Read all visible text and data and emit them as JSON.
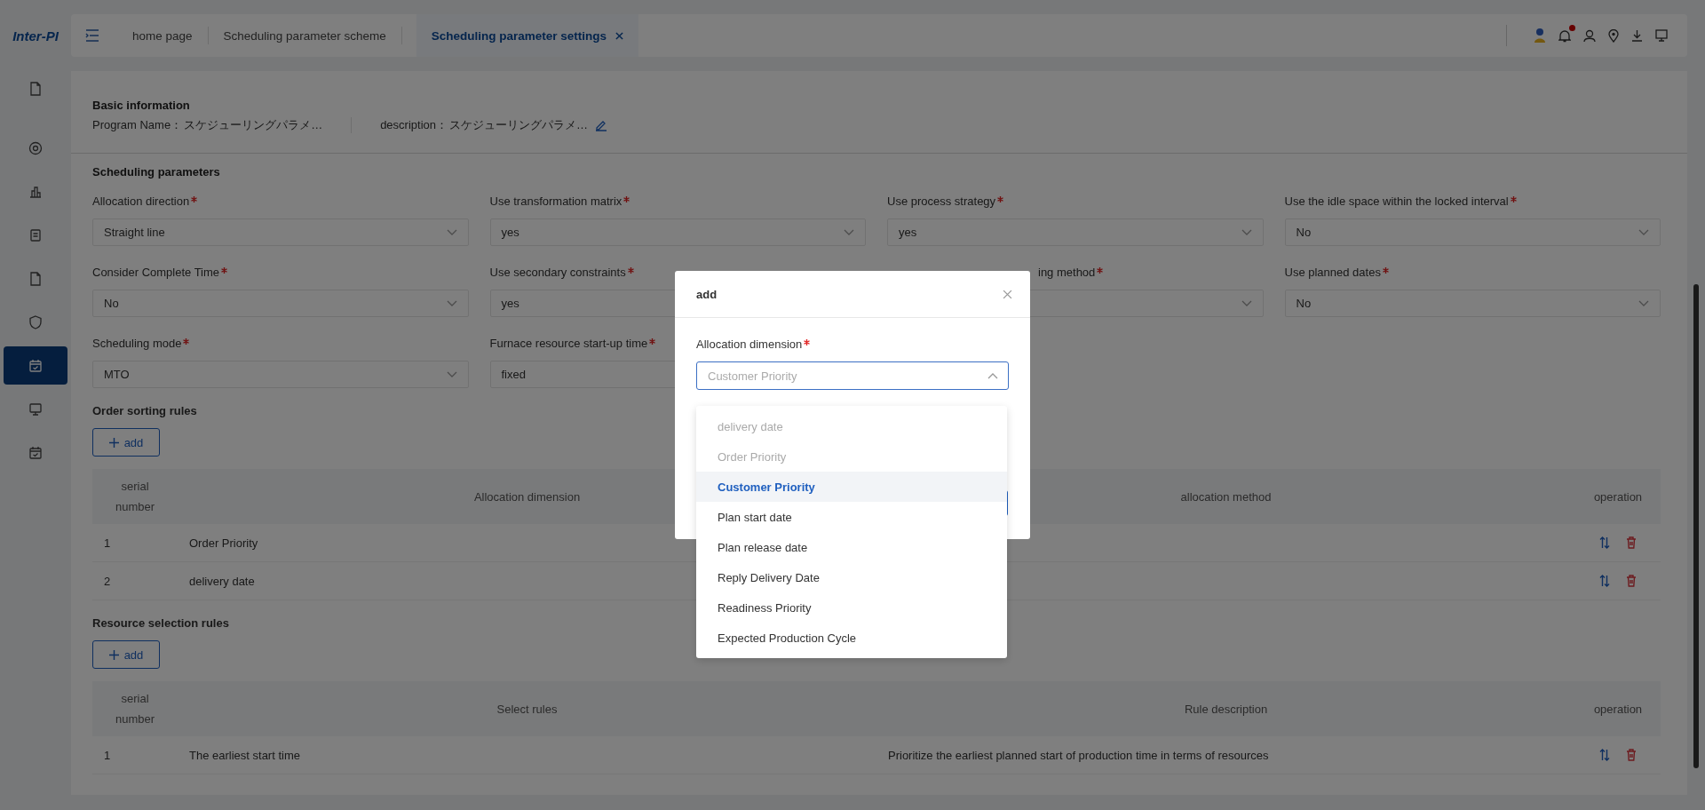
{
  "brand": {
    "logo": "Inter-PI"
  },
  "sidebar": {
    "items": [
      {
        "selected": false
      },
      {
        "selected": false
      },
      {
        "selected": false
      },
      {
        "selected": false
      },
      {
        "selected": false
      },
      {
        "selected": false
      },
      {
        "selected": true
      },
      {
        "selected": false
      },
      {
        "selected": false
      }
    ]
  },
  "tabs": [
    {
      "label": "home page",
      "selected": false
    },
    {
      "label": "Scheduling parameter scheme",
      "selected": false
    },
    {
      "label": "Scheduling parameter settings",
      "selected": true
    }
  ],
  "notifications": {
    "unread": true
  },
  "basic_information": {
    "title": "Basic information",
    "fields": [
      {
        "label": "Program Name：",
        "value": "スケジューリングパラメ…",
        "editable": false
      },
      {
        "label": "description：",
        "value": "スケジューリングパラメ…",
        "editable": true
      }
    ]
  },
  "scheduling_parameters": {
    "title": "Scheduling parameters",
    "fields": [
      {
        "label": "Allocation direction",
        "required": true,
        "value": "Straight line"
      },
      {
        "label": "Use transformation matrix",
        "required": true,
        "value": "yes"
      },
      {
        "label": "Use process strategy",
        "required": true,
        "value": "yes"
      },
      {
        "label": "Use the idle space within the locked interval",
        "required": true,
        "value": "No"
      },
      {
        "label": "Consider Complete Time",
        "required": true,
        "value": "No"
      },
      {
        "label": "Use secondary constraints",
        "required": true,
        "value": "yes"
      },
      {
        "label": "ing method",
        "required": true,
        "covered": true
      },
      {
        "label": "Use planned dates",
        "required": true,
        "value": "No"
      },
      {
        "label": "Scheduling mode",
        "required": true,
        "value": "MTO"
      },
      {
        "label": "Furnace resource start-up time",
        "required": true,
        "value": "fixed"
      }
    ]
  },
  "order_sorting_rules": {
    "title": "Order sorting rules",
    "add_button": "add",
    "table": {
      "columns": [
        "serial number",
        "Allocation dimension",
        "allocation method",
        "operation"
      ],
      "rows": [
        {
          "cells": [
            "1",
            "Order Priority"
          ]
        },
        {
          "cells": [
            "2",
            "delivery date"
          ]
        }
      ]
    }
  },
  "resource_selection_rules": {
    "title": "Resource selection rules",
    "add_button": "add",
    "table": {
      "columns": [
        "serial number",
        "Select rules",
        "Rule description",
        "operation"
      ],
      "rows": [
        {
          "cells": [
            "1",
            "The earliest start time",
            "Prioritize the earliest planned start of production time in terms of resources"
          ]
        }
      ]
    }
  },
  "dialog": {
    "title": "add",
    "field": {
      "label": "Allocation dimension",
      "required": true,
      "placeholder": "Customer Priority",
      "expanded": true
    },
    "options": [
      {
        "label": "delivery date",
        "disabled": true,
        "selected": false
      },
      {
        "label": "Order Priority",
        "disabled": true,
        "selected": false
      },
      {
        "label": "Customer Priority",
        "disabled": false,
        "selected": true
      },
      {
        "label": "Plan start date",
        "disabled": false,
        "selected": false
      },
      {
        "label": "Plan release date",
        "disabled": false,
        "selected": false
      },
      {
        "label": "Reply Delivery Date",
        "disabled": false,
        "selected": false
      },
      {
        "label": "Readiness Priority",
        "disabled": false,
        "selected": false
      },
      {
        "label": "Expected Production Cycle",
        "disabled": false,
        "selected": false
      }
    ]
  }
}
